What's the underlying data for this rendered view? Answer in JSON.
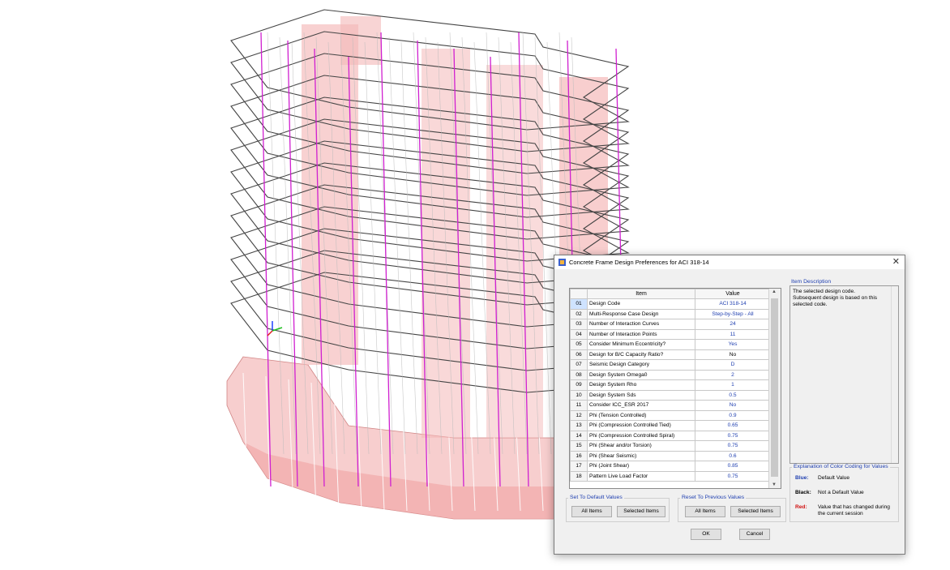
{
  "dialog": {
    "title": "Concrete Frame Design Preferences for ACI 318-14",
    "close": "✕",
    "grid": {
      "col_item": "Item",
      "col_value": "Value",
      "rows": [
        {
          "num": "01",
          "item": "Design Code",
          "value": "ACI 318-14",
          "color": "#1f3fb0"
        },
        {
          "num": "02",
          "item": "Multi-Response Case Design",
          "value": "Step-by-Step - All",
          "color": "#1f3fb0"
        },
        {
          "num": "03",
          "item": "Number of Interaction Curves",
          "value": "24",
          "color": "#1f3fb0"
        },
        {
          "num": "04",
          "item": "Number of Interaction Points",
          "value": "11",
          "color": "#1f3fb0"
        },
        {
          "num": "05",
          "item": "Consider Minimum Eccentricity?",
          "value": "Yes",
          "color": "#1f3fb0"
        },
        {
          "num": "06",
          "item": "Design for B/C Capacity Ratio?",
          "value": "No",
          "color": "#000000"
        },
        {
          "num": "07",
          "item": "Seismic Design Category",
          "value": "D",
          "color": "#1f3fb0"
        },
        {
          "num": "08",
          "item": "Design System Omega0",
          "value": "2",
          "color": "#1f3fb0"
        },
        {
          "num": "09",
          "item": "Design System Rho",
          "value": "1",
          "color": "#1f3fb0"
        },
        {
          "num": "10",
          "item": "Design System Sds",
          "value": "0.5",
          "color": "#1f3fb0"
        },
        {
          "num": "11",
          "item": "Consider ICC_ESR 2017",
          "value": "No",
          "color": "#1f3fb0"
        },
        {
          "num": "12",
          "item": "Phi (Tension Controlled)",
          "value": "0.9",
          "color": "#1f3fb0"
        },
        {
          "num": "13",
          "item": "Phi (Compression Controlled Tied)",
          "value": "0.65",
          "color": "#1f3fb0"
        },
        {
          "num": "14",
          "item": "Phi (Compression Controlled Spiral)",
          "value": "0.75",
          "color": "#1f3fb0"
        },
        {
          "num": "15",
          "item": "Phi (Shear and/or Torsion)",
          "value": "0.75",
          "color": "#1f3fb0"
        },
        {
          "num": "16",
          "item": "Phi (Shear Seismic)",
          "value": "0.6",
          "color": "#1f3fb0"
        },
        {
          "num": "17",
          "item": "Phi (Joint Shear)",
          "value": "0.85",
          "color": "#1f3fb0"
        },
        {
          "num": "18",
          "item": "Pattern Live Load Factor",
          "value": "0.75",
          "color": "#1f3fb0"
        }
      ]
    },
    "description": {
      "label": "Item Description",
      "text": "The selected design code. Subsequent design is based on this selected code."
    },
    "legend": {
      "title": "Explanation of Color Coding for Values",
      "blue_key": "Blue:",
      "blue_val": "Default Value",
      "black_key": "Black:",
      "black_val": "Not a Default Value",
      "red_key": "Red:",
      "red_val": "Value that has changed during the current session"
    },
    "set_default": {
      "title": "Set To Default Values",
      "all": "All Items",
      "selected": "Selected Items"
    },
    "reset_previous": {
      "title": "Reset To Previous Values",
      "all": "All Items",
      "selected": "Selected Items"
    },
    "ok": "OK",
    "cancel": "Cancel"
  },
  "colors": {
    "blue_text": "#1f3fb0",
    "red_text": "#d01010",
    "wall_pink": "#f4b8b8",
    "slab_line": "#333333",
    "column_magenta": "#d020d0"
  }
}
